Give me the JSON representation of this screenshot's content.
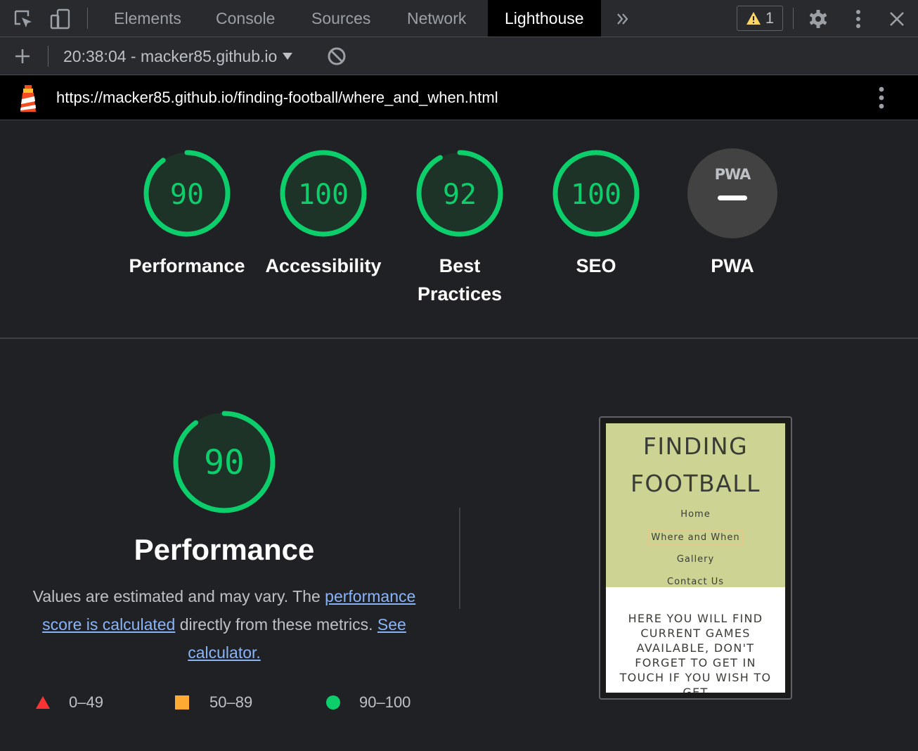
{
  "tabs": {
    "items": [
      {
        "label": "Elements"
      },
      {
        "label": "Console"
      },
      {
        "label": "Sources"
      },
      {
        "label": "Network"
      },
      {
        "label": "Lighthouse",
        "active": true
      }
    ],
    "more_icon": "chevron-double-right-icon",
    "warning_count": "1",
    "icons": [
      "inspect-element-icon",
      "device-toolbar-icon",
      "warning-icon",
      "gear-icon",
      "kebab-menu-icon",
      "close-icon"
    ]
  },
  "session": {
    "report": "20:38:04 - macker85.github.io",
    "icons": [
      "plus-icon",
      "dropdown-caret-icon",
      "clear-block-icon"
    ]
  },
  "urlbar": {
    "url": "https://macker85.github.io/finding-football/where_and_when.html",
    "icons": [
      "lighthouse-logo-icon",
      "kebab-menu-icon"
    ]
  },
  "categories": [
    {
      "label": "Performance",
      "score": "90",
      "value": 90
    },
    {
      "label": "Accessibility",
      "score": "100",
      "value": 100
    },
    {
      "label_line1": "Best",
      "label_line2": "Practices",
      "score": "92",
      "value": 92
    },
    {
      "label": "SEO",
      "score": "100",
      "value": 100
    },
    {
      "label": "PWA",
      "badge": "PWA",
      "score": "—"
    }
  ],
  "performance": {
    "score": "90",
    "value": 90,
    "title": "Performance",
    "desc_prefix": "Values are estimated and may vary. The ",
    "desc_link1": "performance score is calculated",
    "desc_middle": " directly from these metrics. ",
    "desc_link2": "See calculator."
  },
  "legend": [
    {
      "range": "0–49",
      "color": "#ff3333",
      "shape": "triangle"
    },
    {
      "range": "50–89",
      "color": "#ffaa33",
      "shape": "square"
    },
    {
      "range": "90–100",
      "color": "#0cce6b",
      "shape": "circle"
    }
  ],
  "thumbnail": {
    "title_line1": "FINDING",
    "title_line2": "FOOTBALL",
    "nav": [
      "Home",
      "Where and When",
      "Gallery",
      "Contact Us"
    ],
    "body": "HERE YOU WILL FIND CURRENT GAMES AVAILABLE, DON'T FORGET TO GET IN TOUCH IF YOU WISH TO GET"
  },
  "colors": {
    "pass": "#0cce6b",
    "gauge_bg": "#1e3328",
    "link": "#8ab4f8",
    "panel_bg": "#202124"
  }
}
